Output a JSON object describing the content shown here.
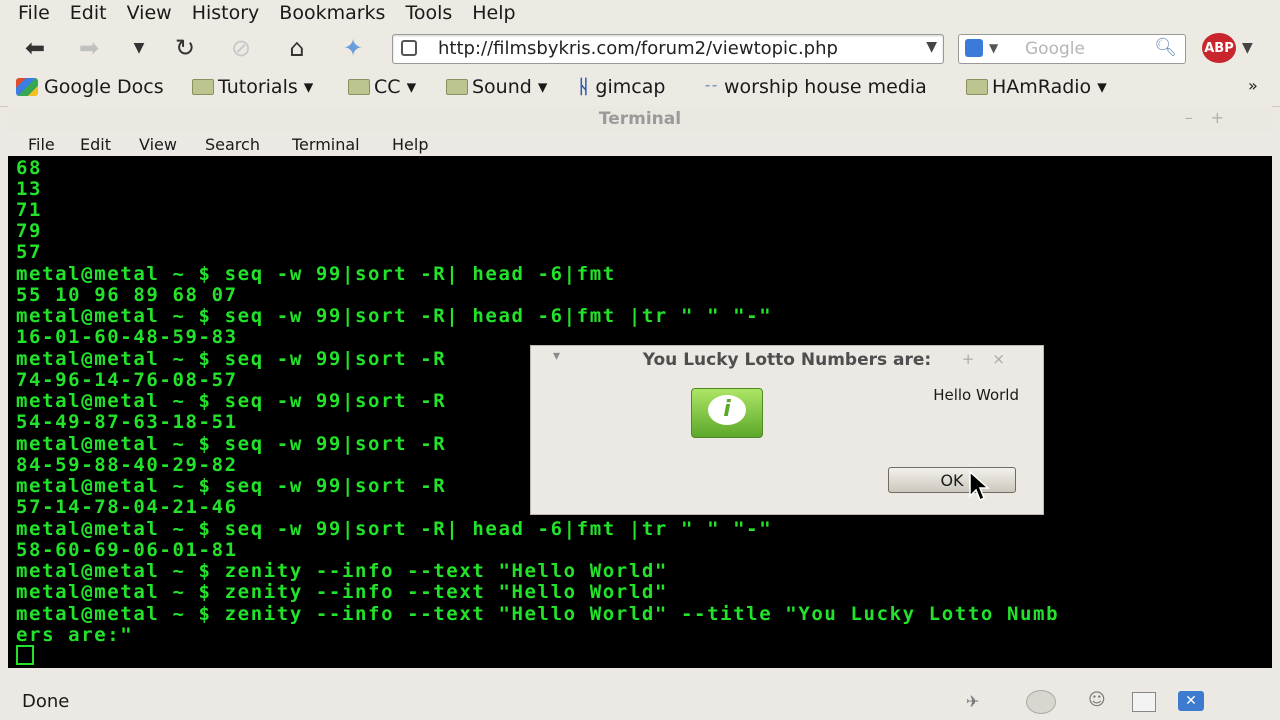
{
  "browser": {
    "menu": [
      "File",
      "Edit",
      "View",
      "History",
      "Bookmarks",
      "Tools",
      "Help"
    ],
    "url": "http://filmsbykris.com/forum2/viewtopic.php",
    "search_placeholder": "Google",
    "abp_label": "ABP",
    "bookmarks": [
      "Google Docs",
      "Tutorials ▾",
      "CC ▾",
      "Sound ▾",
      "gimcap",
      "worship house media",
      "HAmRadio ▾"
    ],
    "overflow": "»",
    "status": "Done"
  },
  "terminal": {
    "title": "Terminal",
    "menu": [
      "File",
      "Edit",
      "View",
      "Search",
      "Terminal",
      "Help"
    ],
    "lines": [
      "68",
      "13",
      "71",
      "79",
      "57",
      "metal@metal ~ $ seq -w 99|sort -R| head -6|fmt",
      "55 10 96 89 68 07",
      "metal@metal ~ $ seq -w 99|sort -R| head -6|fmt |tr \" \" \"-\"",
      "16-01-60-48-59-83",
      "metal@metal ~ $ seq -w 99|sort -R",
      "74-96-14-76-08-57",
      "metal@metal ~ $ seq -w 99|sort -R",
      "54-49-87-63-18-51",
      "metal@metal ~ $ seq -w 99|sort -R",
      "84-59-88-40-29-82",
      "metal@metal ~ $ seq -w 99|sort -R",
      "57-14-78-04-21-46",
      "metal@metal ~ $ seq -w 99|sort -R| head -6|fmt |tr \" \" \"-\"",
      "58-60-69-06-01-81",
      "metal@metal ~ $ zenity --info --text \"Hello World\"",
      "metal@metal ~ $ zenity --info --text \"Hello World\"",
      "metal@metal ~ $ zenity --info --text \"Hello World\" --title \"You Lucky Lotto Numb",
      "ers are:\""
    ]
  },
  "dialog": {
    "title": "You Lucky Lotto Numbers are:",
    "message": "Hello World",
    "ok_label": "OK"
  }
}
